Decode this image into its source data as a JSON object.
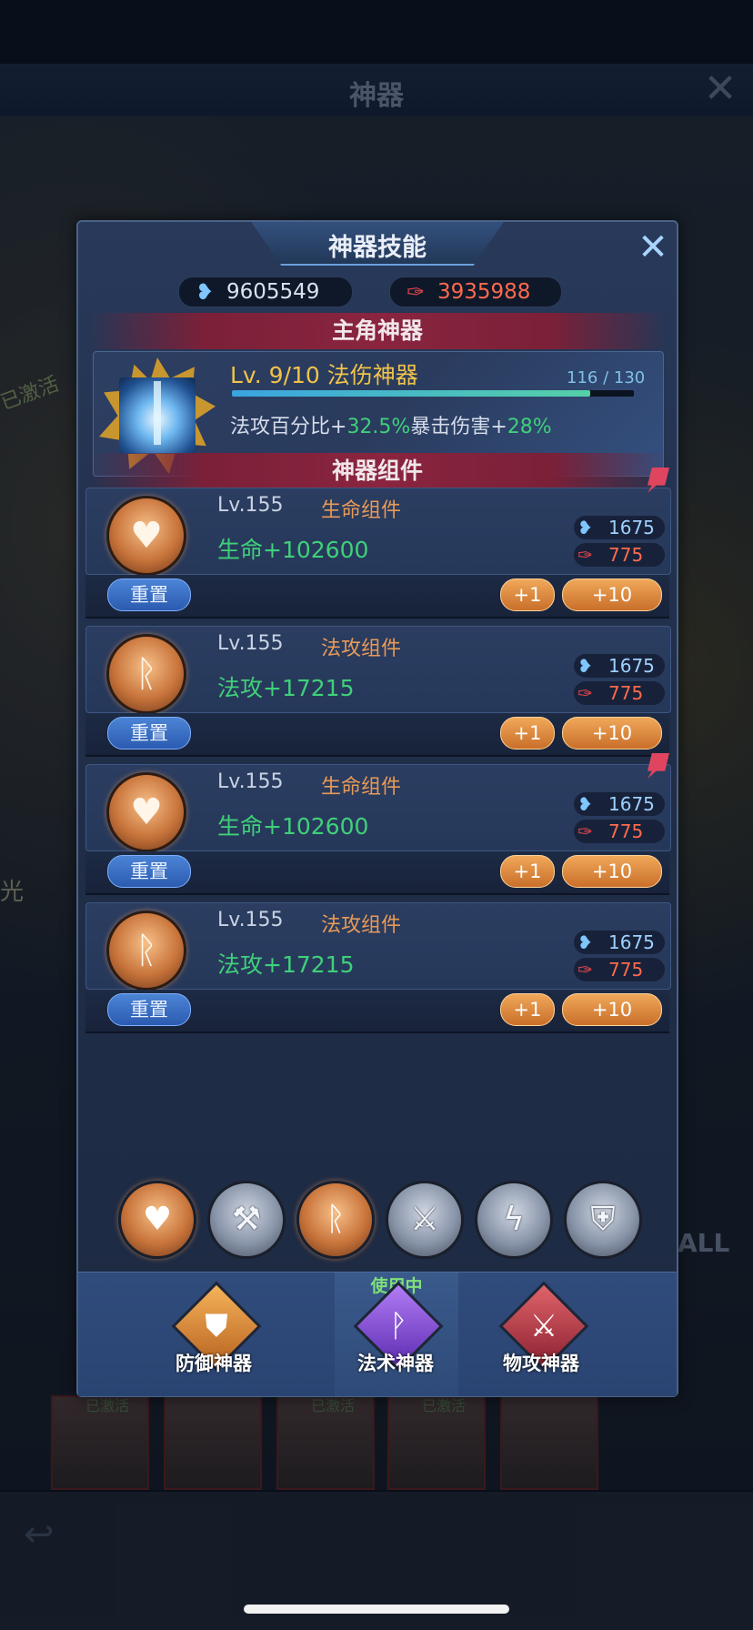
{
  "background": {
    "title": "神器",
    "left_tag": "已激活",
    "left_char": "光",
    "all_label": "ALL",
    "card_labels": [
      "已激活",
      "",
      "已激活",
      "已激活",
      ""
    ]
  },
  "dialog": {
    "title": "神器技能",
    "currencies": {
      "blue": {
        "icon": "blue-heart-gem-icon",
        "value": "9605549"
      },
      "red": {
        "icon": "red-feather-icon",
        "value": "3935988"
      }
    },
    "main_section_title": "主角神器",
    "main_artifact": {
      "level_text": "Lv.  9/10 法伤神器",
      "progress_text": "116 / 130",
      "progress_current": 116,
      "progress_max": 130,
      "stats_prefix": "法攻百分比+",
      "stat1_value": "32.5%",
      "stats_mid": "暴击伤害+",
      "stat2_value": "28%"
    },
    "components_section_title": "神器组件",
    "components": [
      {
        "level": "Lv.155",
        "name": "生命组件",
        "stat": "生命+102600",
        "icon": "heart-icon",
        "cost_blue": "1675",
        "cost_red": "775",
        "reset_label": "重置",
        "plus1_label": "+1",
        "plus10_label": "+10",
        "has_badge": true
      },
      {
        "level": "Lv.155",
        "name": "法攻组件",
        "stat": "法攻+17215",
        "icon": "rune-icon",
        "cost_blue": "1675",
        "cost_red": "775",
        "reset_label": "重置",
        "plus1_label": "+1",
        "plus10_label": "+10",
        "has_badge": false
      },
      {
        "level": "Lv.155",
        "name": "生命组件",
        "stat": "生命+102600",
        "icon": "heart-icon",
        "cost_blue": "1675",
        "cost_red": "775",
        "reset_label": "重置",
        "plus1_label": "+1",
        "plus10_label": "+10",
        "has_badge": true
      },
      {
        "level": "Lv.155",
        "name": "法攻组件",
        "stat": "法攻+17215",
        "icon": "rune-icon",
        "cost_blue": "1675",
        "cost_red": "775",
        "reset_label": "重置",
        "plus1_label": "+1",
        "plus10_label": "+10",
        "has_badge": false
      }
    ],
    "slots": [
      {
        "icon": "heart-icon",
        "active": true
      },
      {
        "icon": "axe-icon",
        "active": false
      },
      {
        "icon": "rune-icon",
        "active": true
      },
      {
        "icon": "shield-sword-icon",
        "active": false
      },
      {
        "icon": "lightning-shield-icon",
        "active": false
      },
      {
        "icon": "shield-bolt-icon",
        "active": false
      }
    ],
    "in_use_label": "使用中",
    "types": [
      {
        "label": "防御神器",
        "icon": "orange-shield-icon"
      },
      {
        "label": "法术神器",
        "icon": "purple-rune-icon"
      },
      {
        "label": "物攻神器",
        "icon": "red-sword-icon"
      }
    ]
  },
  "colors": {
    "green_stat": "#3fd07a",
    "orange_name": "#e79a58",
    "gold_level": "#f0c34a",
    "blue_currency": "#7fc6ff",
    "red_currency": "#ff6a4d"
  }
}
